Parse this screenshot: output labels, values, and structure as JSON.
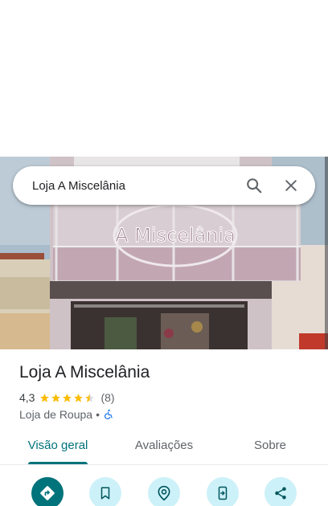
{
  "search": {
    "query": "Loja A Miscelânia",
    "search_icon": "search-icon",
    "clear_icon": "close-icon"
  },
  "photo": {
    "sign_text": "A Miscelânia"
  },
  "place": {
    "name": "Loja A Miscelânia",
    "rating": "4,3",
    "stars": 4.3,
    "review_count": "(8)",
    "category": "Loja de Roupa",
    "separator": "•",
    "accessibility_icon": "wheelchair-icon"
  },
  "tabs": [
    {
      "label": "Visão geral",
      "active": true
    },
    {
      "label": "Avaliações",
      "active": false
    },
    {
      "label": "Sobre",
      "active": false
    }
  ],
  "actions": [
    {
      "icon": "directions-icon"
    },
    {
      "icon": "bookmark-icon"
    },
    {
      "icon": "nearby-icon"
    },
    {
      "icon": "send-to-phone-icon"
    },
    {
      "icon": "share-icon"
    }
  ],
  "colors": {
    "accent": "#00737b",
    "action_bg": "#cdf1f8",
    "star": "#fbbc04",
    "accessibility": "#1a73e8"
  }
}
